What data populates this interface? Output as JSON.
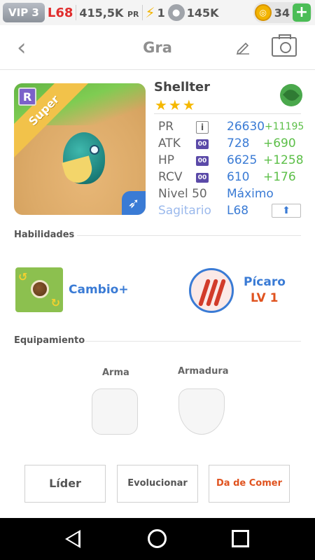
{
  "status": {
    "vip": "VIP 3",
    "level": "L68",
    "pr_value": "415,5K",
    "pr_unit": "PR",
    "energy": "1",
    "paws": "145K",
    "coins": "34"
  },
  "header": {
    "title": "Gra"
  },
  "monster": {
    "rarity_badge": "R",
    "ribbon": "Super",
    "name": "Shellter",
    "stars": "★★★",
    "stats": {
      "pr_label": "PR",
      "pr_value": "26630",
      "pr_bonus": "+11195",
      "atk_label": "ATK",
      "atk_badge": "00",
      "atk_value": "728",
      "atk_bonus": "+690",
      "hp_label": "HP",
      "hp_badge": "00",
      "hp_value": "6625",
      "hp_bonus": "+1258",
      "rcv_label": "RCV",
      "rcv_badge": "00",
      "rcv_value": "610",
      "rcv_bonus": "+176",
      "level_label": "Nivel 50",
      "level_value": "Máximo",
      "sign_label": "Sagitario",
      "sign_value": "L68"
    }
  },
  "skills": {
    "section_label": "Habilidades",
    "skill_name": "Cambio+",
    "class_name": "Pícaro",
    "class_level": "LV 1"
  },
  "equipment": {
    "section_label": "Equipamiento",
    "weapon_label": "Arma",
    "armor_label": "Armadura"
  },
  "actions": {
    "leader": "Líder",
    "evolve": "Evolucionar",
    "feed": "Da de Comer"
  },
  "icons": {
    "energy": "lightning-icon",
    "paws": "paw-icon",
    "coins": "coin-icon",
    "add": "plus-icon",
    "back": "chevron-left-icon",
    "edit": "pencil-icon",
    "camera": "camera-icon",
    "element": "leaf-icon",
    "info": "info-icon",
    "upgrade": "up-arrow-icon",
    "sign": "sagittarius-icon"
  }
}
